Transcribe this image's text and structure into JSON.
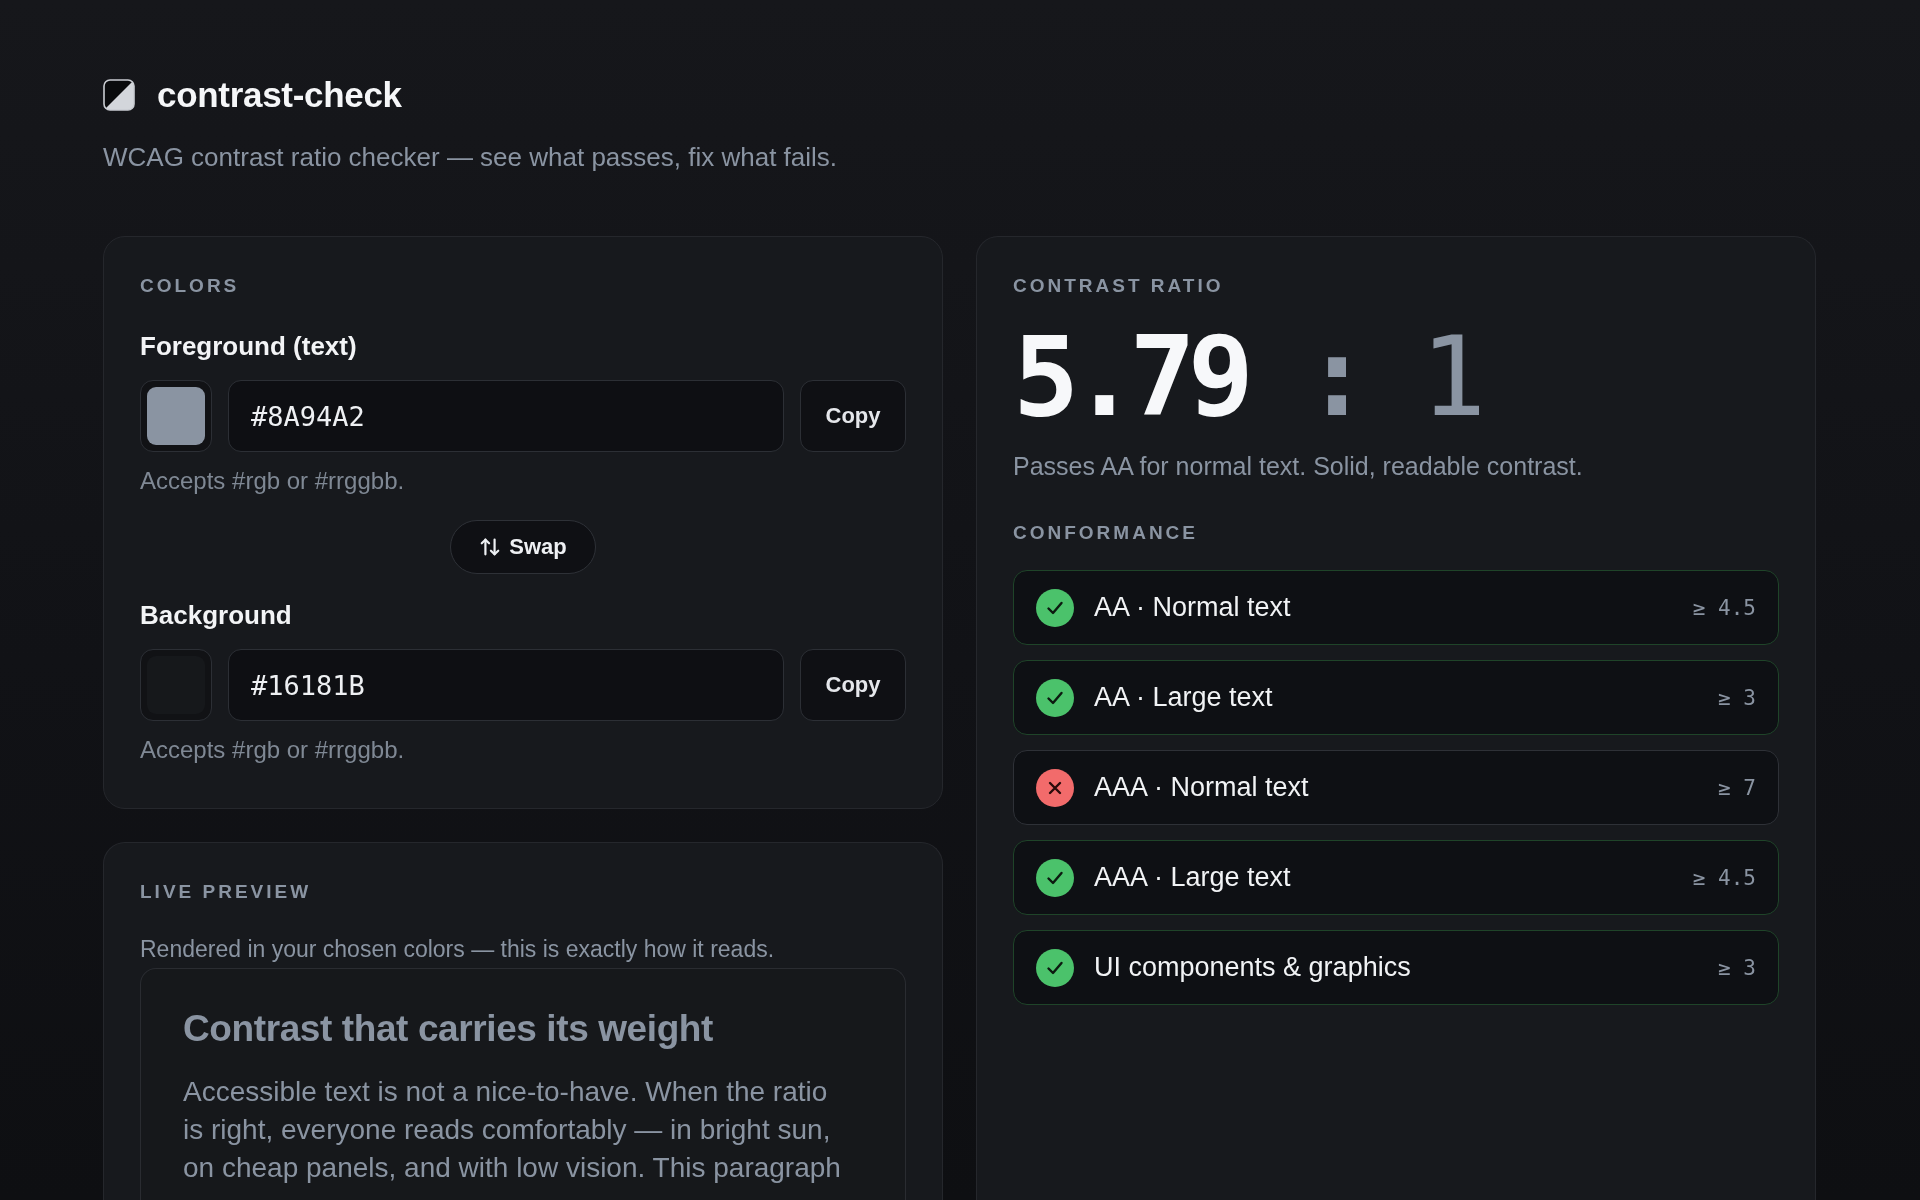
{
  "header": {
    "title": "contrast-check",
    "subtitle": "WCAG contrast ratio checker — see what passes, fix what fails."
  },
  "colors": {
    "heading": "COLORS",
    "fields": [
      {
        "label": "Foreground (text)",
        "value": "#8A94A2",
        "hint": "Accepts #rgb or #rrggbb.",
        "copy_button": "Copy"
      },
      {
        "label": "Background",
        "value": "#16181B",
        "hint": "Accepts #rgb or #rrggbb.",
        "copy_button": "Copy"
      }
    ],
    "swap_button": "Swap"
  },
  "live_preview": {
    "heading": "LIVE PREVIEW",
    "caption": "Rendered in your chosen colors — this is exactly how it reads.",
    "sample_heading": "Contrast that carries its weight",
    "sample_lines": [
      "Accessible text is not a nice-to-have. When the ratio",
      "is right, everyone reads comfortably — in bright sun,",
      "on cheap panels, and with low vision. This paragraph"
    ]
  },
  "contrast_ratio": {
    "heading": "CONTRAST RATIO",
    "ratio": {
      "value": "5.79",
      "separator": ":",
      "base": "1"
    },
    "summary": "Passes AA for normal text. Solid, readable contrast."
  },
  "conformance": {
    "heading": "CONFORMANCE",
    "checks": [
      {
        "label": "AA · Normal text",
        "threshold": "≥ 4.5",
        "passed": true
      },
      {
        "label": "AA · Large text",
        "threshold": "≥ 3",
        "passed": true
      },
      {
        "label": "AAA · Normal text",
        "threshold": "≥ 7",
        "passed": false
      },
      {
        "label": "AAA · Large text",
        "threshold": "≥ 4.5",
        "passed": true
      },
      {
        "label": "UI components & graphics",
        "threshold": "≥ 3",
        "passed": true
      }
    ]
  }
}
